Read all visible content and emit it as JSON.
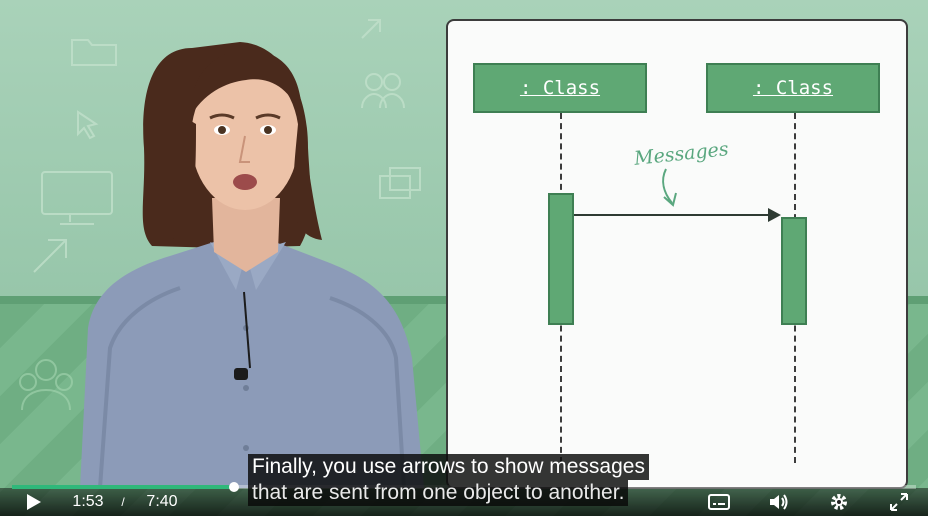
{
  "diagram": {
    "left_class": ": Class",
    "right_class": ": Class",
    "message_label": "Messages"
  },
  "captions": {
    "line1": "Finally, you use arrows to show messages",
    "line2": "that are sent from one object to another."
  },
  "player": {
    "current_time": "1:53",
    "separator": "/",
    "duration": "7:40",
    "progress_fraction": 0.246,
    "icons": {
      "play": "play-icon",
      "captions": "closed-captions-icon",
      "volume": "volume-icon",
      "settings": "gear-icon",
      "fullscreen": "fullscreen-icon"
    }
  },
  "colors": {
    "accent": "#2fb87a",
    "diagram_green": "#5fa874"
  }
}
